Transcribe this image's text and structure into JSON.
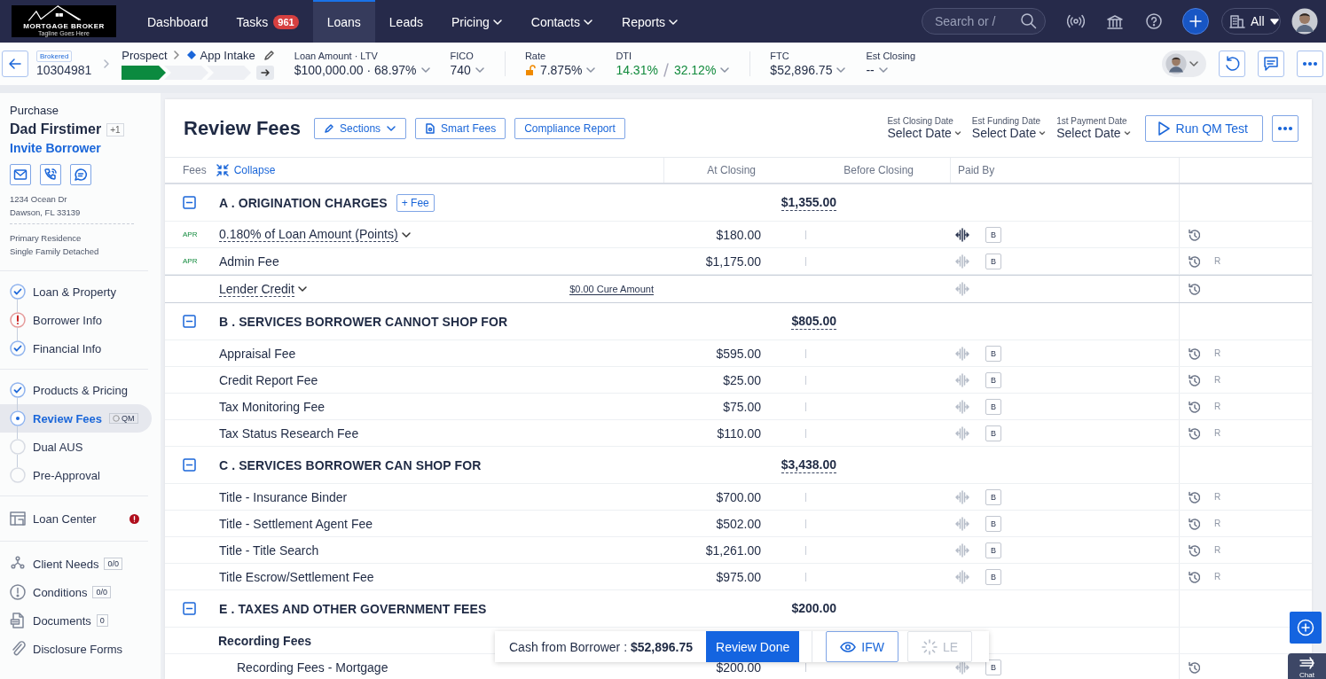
{
  "nav": {
    "logo": {
      "name": "MORTGAGE BROKER",
      "tagline": "Tagline Goes Here"
    },
    "items": [
      {
        "label": "Dashboard",
        "selected": false
      },
      {
        "label": "Tasks",
        "badge": "961",
        "selected": false
      },
      {
        "label": "Loans",
        "selected": true
      },
      {
        "label": "Leads",
        "selected": false
      },
      {
        "label": "Pricing",
        "dropdown": true,
        "selected": false
      },
      {
        "label": "Contacts",
        "dropdown": true,
        "selected": false
      },
      {
        "label": "Reports",
        "dropdown": true,
        "selected": false
      }
    ],
    "search": {
      "placeholder": "Search or /"
    },
    "scope": {
      "label": "All"
    }
  },
  "loan_bar": {
    "channel": "Brokered",
    "loan_number": "10304981",
    "stage": "Prospect",
    "status": "App Intake",
    "progress": [
      {
        "done": true
      },
      {
        "done": false
      },
      {
        "done": false
      }
    ],
    "metrics": [
      {
        "kind": "plain",
        "label": "Loan Amount · LTV",
        "values": [
          "$100,000.00 · 68.97%"
        ],
        "divider_after": false
      },
      {
        "kind": "plain",
        "label": "FICO",
        "values": [
          "740"
        ],
        "divider_after": true
      },
      {
        "kind": "rate",
        "label": "Rate",
        "values": [
          "7.875%"
        ],
        "divider_after": false
      },
      {
        "kind": "ratio",
        "label": "DTI",
        "values": [
          "14.31%",
          "32.12%"
        ],
        "divider_after": true
      },
      {
        "kind": "plain",
        "label": "FTC",
        "values": [
          "$52,896.75"
        ],
        "divider_after": false
      },
      {
        "kind": "plain",
        "label": "Est Closing",
        "values": [
          "--"
        ],
        "divider_after": false
      }
    ]
  },
  "sidebar": {
    "loan_purpose": "Purchase",
    "borrower": "Dad Firstimer",
    "co_borrowers": "+1",
    "invite": "Invite Borrower",
    "address": [
      "1234 Ocean Dr",
      "Dawson, FL 33139"
    ],
    "property": [
      "Primary Residence",
      "Single Family Detached"
    ],
    "step_groups": [
      [
        {
          "label": "Loan & Property",
          "kind": "done",
          "selected": false
        },
        {
          "label": "Borrower Info",
          "kind": "error",
          "selected": false
        },
        {
          "label": "Financial Info",
          "kind": "done",
          "selected": false
        }
      ],
      [
        {
          "label": "Products & Pricing",
          "kind": "done",
          "selected": false
        },
        {
          "label": "Review Fees",
          "kind": "current",
          "badge": "QM",
          "selected": true
        },
        {
          "label": "Dual AUS",
          "kind": "todo",
          "selected": false
        },
        {
          "label": "Pre-Approval",
          "kind": "todo",
          "selected": false
        }
      ]
    ],
    "loan_center": {
      "label": "Loan Center",
      "alert": true
    },
    "tools": [
      {
        "kind": "needs",
        "label": "Client Needs",
        "count": "0/0"
      },
      {
        "kind": "conditions",
        "label": "Conditions",
        "count": "0/0"
      },
      {
        "kind": "documents",
        "label": "Documents",
        "count": "0"
      },
      {
        "kind": "forms",
        "label": "Disclosure Forms"
      }
    ]
  },
  "page": {
    "title": "Review Fees",
    "buttons": [
      {
        "kind": "sections",
        "label": "Sections"
      },
      {
        "kind": "smart",
        "label": "Smart Fees"
      },
      {
        "kind": "plain",
        "label": "Compliance Report"
      }
    ],
    "dates": [
      {
        "label": "Est Closing Date",
        "value": "Select Date"
      },
      {
        "label": "Est Funding Date",
        "value": "Select Date"
      },
      {
        "label": "1st Payment Date",
        "value": "Select Date"
      }
    ],
    "run_button": "Run QM Test"
  },
  "table": {
    "columns": {
      "fees": "Fees",
      "collapse": "Collapse",
      "at_closing": "At Closing",
      "before_closing": "Before Closing",
      "paid_by": "Paid By"
    },
    "sections": [
      {
        "expanded": true,
        "title": "A . ORIGINATION CHARGES",
        "add_fee": "+ Fee",
        "total": "$1,355.00",
        "total_underlined": true,
        "rows": [
          {
            "kind": "fee",
            "apr": "APR",
            "name": "0.180% of Loan Amount (Points)",
            "dropdown": true,
            "amount": "$180.00",
            "split_active": true,
            "payer": "B"
          },
          {
            "kind": "fee",
            "apr": "APR",
            "name": "Admin Fee",
            "amount": "$1,175.00",
            "split_active": false,
            "payer": "B",
            "r": "R"
          },
          {
            "kind": "credit",
            "name": "Lender Credit",
            "dropdown": true,
            "cure": "$0.00 Cure Amount",
            "split_active": false
          }
        ]
      },
      {
        "expanded": true,
        "title": "B . SERVICES BORROWER CANNOT SHOP FOR",
        "total": "$805.00",
        "total_underlined": true,
        "rows": [
          {
            "kind": "fee",
            "name": "Appraisal Fee",
            "amount": "$595.00",
            "split_active": false,
            "payer": "B",
            "r": "R"
          },
          {
            "kind": "fee",
            "name": "Credit Report Fee",
            "amount": "$25.00",
            "split_active": false,
            "payer": "B",
            "r": "R"
          },
          {
            "kind": "fee",
            "name": "Tax Monitoring Fee",
            "amount": "$75.00",
            "split_active": false,
            "payer": "B",
            "r": "R"
          },
          {
            "kind": "fee",
            "name": "Tax Status Research Fee",
            "amount": "$110.00",
            "split_active": false,
            "payer": "B",
            "r": "R"
          }
        ]
      },
      {
        "expanded": true,
        "title": "C . SERVICES BORROWER CAN SHOP FOR",
        "total": "$3,438.00",
        "total_underlined": true,
        "rows": [
          {
            "kind": "fee",
            "name": "Title - Insurance Binder",
            "amount": "$700.00",
            "split_active": false,
            "payer": "B",
            "r": "R"
          },
          {
            "kind": "fee",
            "name": "Title - Settlement Agent Fee",
            "amount": "$502.00",
            "split_active": false,
            "payer": "B",
            "r": "R"
          },
          {
            "kind": "fee",
            "name": "Title - Title Search",
            "amount": "$1,261.00",
            "split_active": false,
            "payer": "B",
            "r": "R"
          },
          {
            "kind": "fee",
            "name": "Title Escrow/Settlement Fee",
            "amount": "$975.00",
            "split_active": false,
            "payer": "B",
            "r": "R"
          }
        ]
      },
      {
        "expanded": true,
        "title": "E . TAXES AND OTHER GOVERNMENT FEES",
        "total": "$200.00",
        "total_underlined": false,
        "rows": [
          {
            "kind": "group",
            "name": "Recording Fees",
            "children": [
              {
                "kind": "fee",
                "name": "Recording Fees - Mortgage",
                "amount": "$200.00",
                "split_active": false,
                "payer": "B"
              }
            ]
          }
        ]
      }
    ]
  },
  "footer_bar": {
    "cash_text": "Cash from Borrower : **$52,896.75**",
    "review_button": "Review Done",
    "ifw_button": "IFW",
    "le_button": {
      "label": "LE",
      "disabled": true
    }
  },
  "chat": {
    "label": "Chat"
  }
}
